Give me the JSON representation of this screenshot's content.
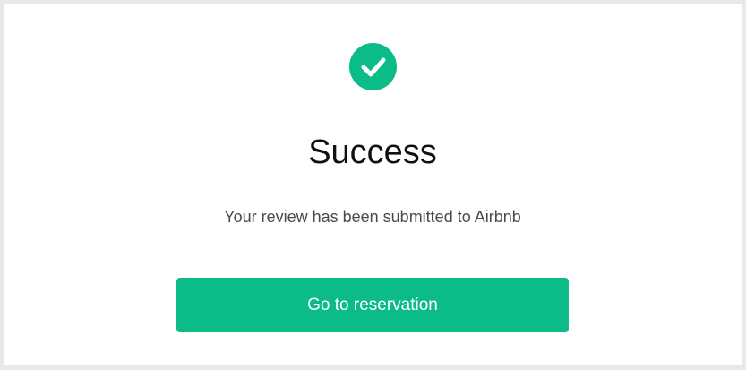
{
  "colors": {
    "accent": "#0bbb88",
    "background": "#e8e8e8",
    "card": "#ffffff"
  },
  "icon": {
    "name": "check-circle-icon"
  },
  "title": "Success",
  "message": "Your review has been submitted to Airbnb",
  "button": {
    "label": "Go to reservation"
  }
}
